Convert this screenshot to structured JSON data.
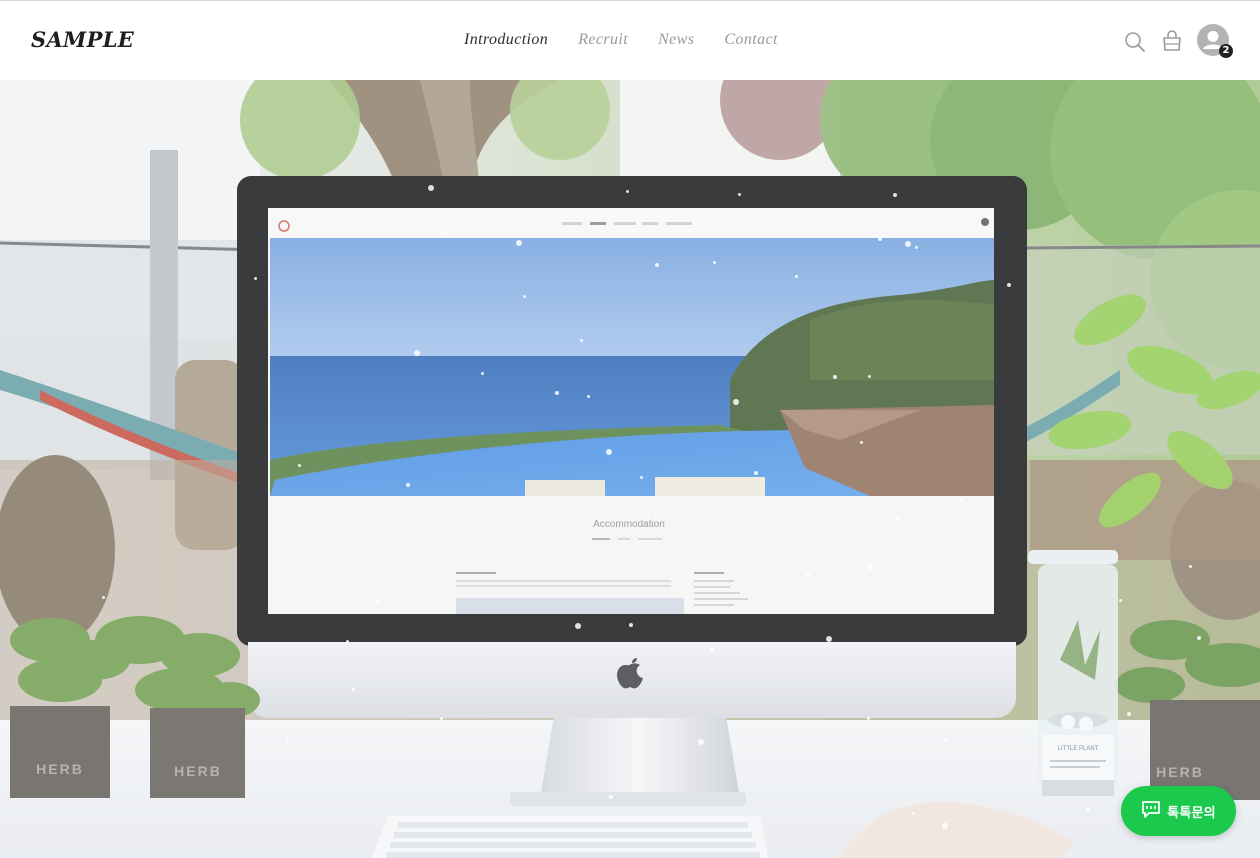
{
  "header": {
    "logo": "SAMPLE",
    "nav": [
      {
        "label": "Introduction",
        "active": true
      },
      {
        "label": "Recruit",
        "active": false
      },
      {
        "label": "News",
        "active": false
      },
      {
        "label": "Contact",
        "active": false
      }
    ],
    "icons": [
      "search-icon",
      "shopping-bag-icon",
      "user-avatar-icon"
    ],
    "cart_badge": "2"
  },
  "hero": {
    "screen_heading": "Accommodation",
    "pot_brand": "HERB",
    "jar_label": "LITTLE PLANT"
  },
  "chat": {
    "label": "톡톡문의",
    "color": "#1bc94d"
  }
}
